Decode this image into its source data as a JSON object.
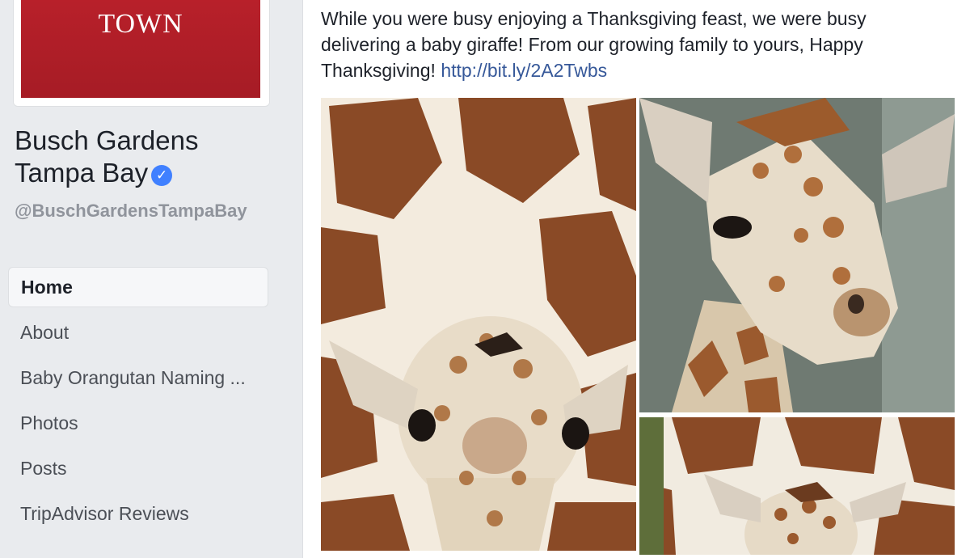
{
  "page": {
    "logo_text": "TOWN",
    "name": "Busch Gardens Tampa Bay",
    "verified_symbol": "✓",
    "handle": "@BuschGardensTampaBay"
  },
  "nav": {
    "items": [
      {
        "label": "Home",
        "active": true
      },
      {
        "label": "About"
      },
      {
        "label": "Baby Orangutan Naming ..."
      },
      {
        "label": "Photos"
      },
      {
        "label": "Posts"
      },
      {
        "label": "TripAdvisor Reviews"
      }
    ]
  },
  "post": {
    "text": "While you were busy enjoying a Thanksgiving feast, we were busy delivering a baby giraffe! From our growing family to yours, Happy Thanksgiving!",
    "link": "http://bit.ly/2A2Twbs",
    "photos": [
      {
        "subject": "baby giraffe face close-up"
      },
      {
        "subject": "baby giraffe profile"
      },
      {
        "subject": "baby giraffe with adult"
      }
    ]
  },
  "colors": {
    "background": "#e9ebee",
    "link": "#365899",
    "verified": "#4080ff",
    "brand_red": "#b8202a",
    "giraffe_brown": "#8a4a26",
    "giraffe_cream": "#f3ebde"
  }
}
